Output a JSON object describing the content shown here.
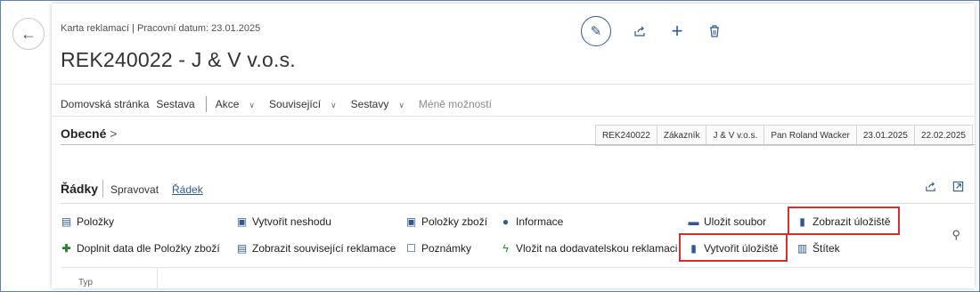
{
  "header": {
    "caption": "Karta reklamací | Pracovní datum: 23.01.2025",
    "title": "REK240022 - J & V v.o.s."
  },
  "actionbar": {
    "items": [
      "Domovská stránka",
      "Sestava",
      "Akce",
      "Související",
      "Sestavy",
      "Méně možností"
    ]
  },
  "general": {
    "label": "Obecné",
    "chevron": ">",
    "summary": [
      "REK240022",
      "Zákazník",
      "J & V v.o.s.",
      "Pan Roland Wacker",
      "23.01.2025",
      "22.02.2025"
    ]
  },
  "lines": {
    "title": "Řádky",
    "manage": "Spravovat",
    "row": "Řádek",
    "actions": {
      "polozky": "Položky",
      "vytvorit_neshodu": "Vytvořit neshodu",
      "polozky_zbozi": "Položky zboží",
      "informace": "Informace",
      "ulozit_soubor": "Uložit soubor",
      "zobrazit_uloziste": "Zobrazit úložiště",
      "doplnit_data": "Doplnit data dle Položky zboží",
      "zobrazit_souvisejici": "Zobrazit související reklamace",
      "poznamky": "Poznámky",
      "vlozit_dodavatelskou": "Vložit na dodavatelskou reklamaci",
      "vytvorit_uloziste": "Vytvořit úložiště",
      "stitek": "Štítek"
    },
    "column_header": "Typ"
  },
  "icons": {
    "back": "back-arrow-icon",
    "edit": "pencil-icon",
    "share": "share-icon",
    "new": "plus-icon",
    "delete": "trash-icon"
  },
  "colors": {
    "accent": "#2d5a91",
    "highlight": "#d32f2f",
    "green": "#2e7d32"
  }
}
